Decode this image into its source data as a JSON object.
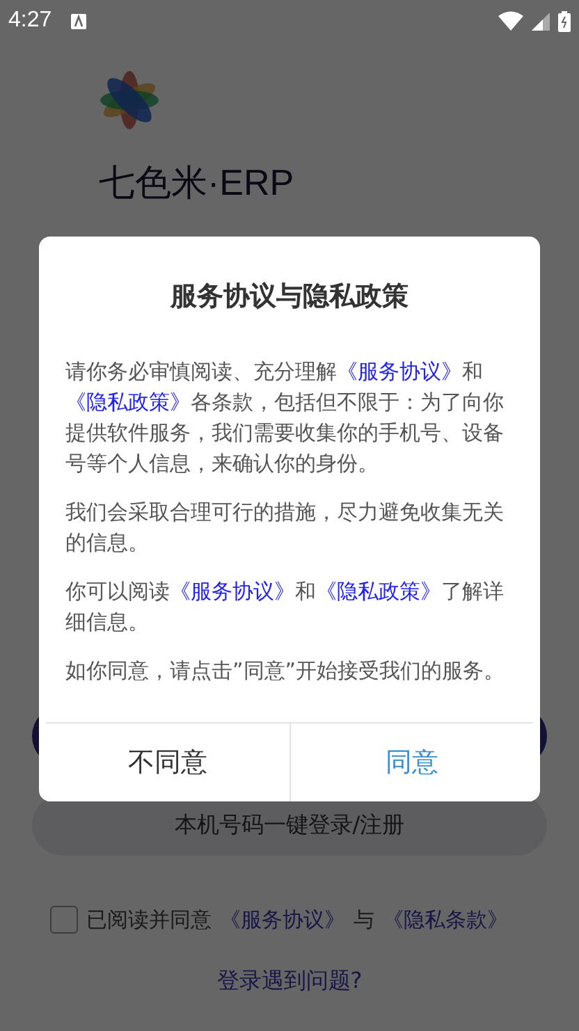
{
  "status_bar": {
    "time": "4:27"
  },
  "app": {
    "title": "七色米·ERP",
    "phone_login_button": "本机号码一键登录/注册",
    "agreement": {
      "checked": false,
      "parts": [
        {
          "text": "已阅读并同意",
          "link": false
        },
        {
          "text": "《服务协议》",
          "link": true
        },
        {
          "text": "与",
          "link": false
        },
        {
          "text": "《隐私条款》",
          "link": true
        }
      ]
    },
    "help_link": "登录遇到问题?"
  },
  "dialog": {
    "title": "服务协议与隐私政策",
    "paragraphs": [
      [
        {
          "text": "请你务必审慎阅读、充分理解",
          "link": false
        },
        {
          "text": "《服务协议》",
          "link": true
        },
        {
          "text": "和",
          "link": false
        },
        {
          "text": "《隐私政策》",
          "link": true
        },
        {
          "text": "各条款，包括但不限于：为了向你提供软件服务，我们需要收集你的手机号、设备号等个人信息，来确认你的身份。",
          "link": false
        }
      ],
      [
        {
          "text": "我们会采取合理可行的措施，尽力避免收集无关的信息。",
          "link": false
        }
      ],
      [
        {
          "text": "你可以阅读",
          "link": false
        },
        {
          "text": "《服务协议》",
          "link": true
        },
        {
          "text": "和",
          "link": false
        },
        {
          "text": "《隐私政策》",
          "link": true
        },
        {
          "text": "了解详细信息。",
          "link": false
        }
      ],
      [
        {
          "text": "如你同意，请点击”同意”开始接受我们的服务。",
          "link": false
        }
      ]
    ],
    "buttons": [
      {
        "label": "不同意",
        "kind": "secondary"
      },
      {
        "label": "同意",
        "kind": "primary"
      }
    ]
  }
}
